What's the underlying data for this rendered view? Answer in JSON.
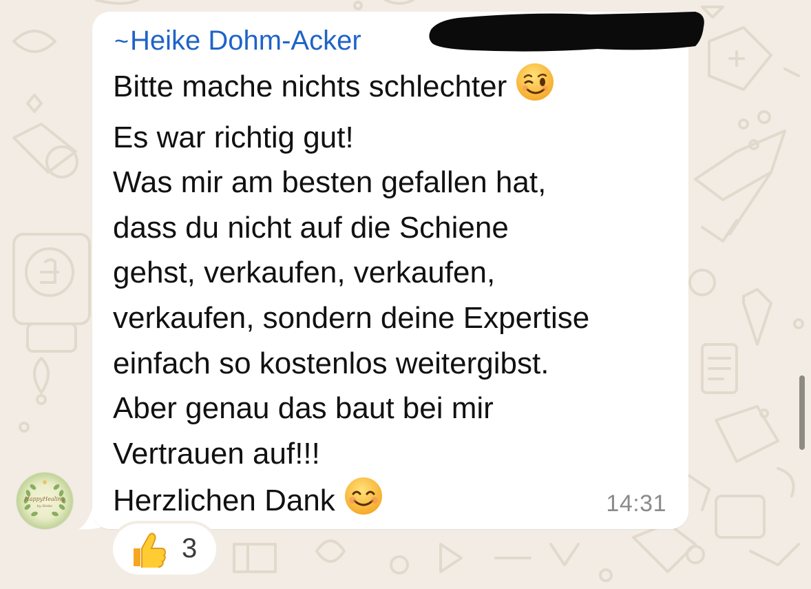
{
  "message": {
    "sender_prefix": "~",
    "sender_name": "Heike Dohm-Acker",
    "lines": [
      "Bitte mache nichts schlechter",
      "Es war richtig gut!",
      "Was mir am besten gefallen hat,",
      "dass du nicht auf die Schiene",
      "gehst, verkaufen, verkaufen,",
      "verkaufen, sondern deine Expertise",
      "einfach so kostenlos weitergibst.",
      "Aber genau das baut bei mir",
      "Vertrauen auf!!!",
      "Herzlichen Dank"
    ],
    "emojis": {
      "line_1": "winking-face-emoji",
      "line_10": "smiling-face-emoji"
    },
    "timestamp": "14:31"
  },
  "avatar": {
    "text": "HappyHealing",
    "subtext": "by Heike"
  },
  "reaction": {
    "icon": "thumbs-up-icon",
    "count": "3"
  },
  "colors": {
    "wallpaper": "#f2ece4",
    "bubble": "#ffffff",
    "sender": "#1f63c9",
    "text": "#111111",
    "timestamp": "#8a8a8a"
  }
}
